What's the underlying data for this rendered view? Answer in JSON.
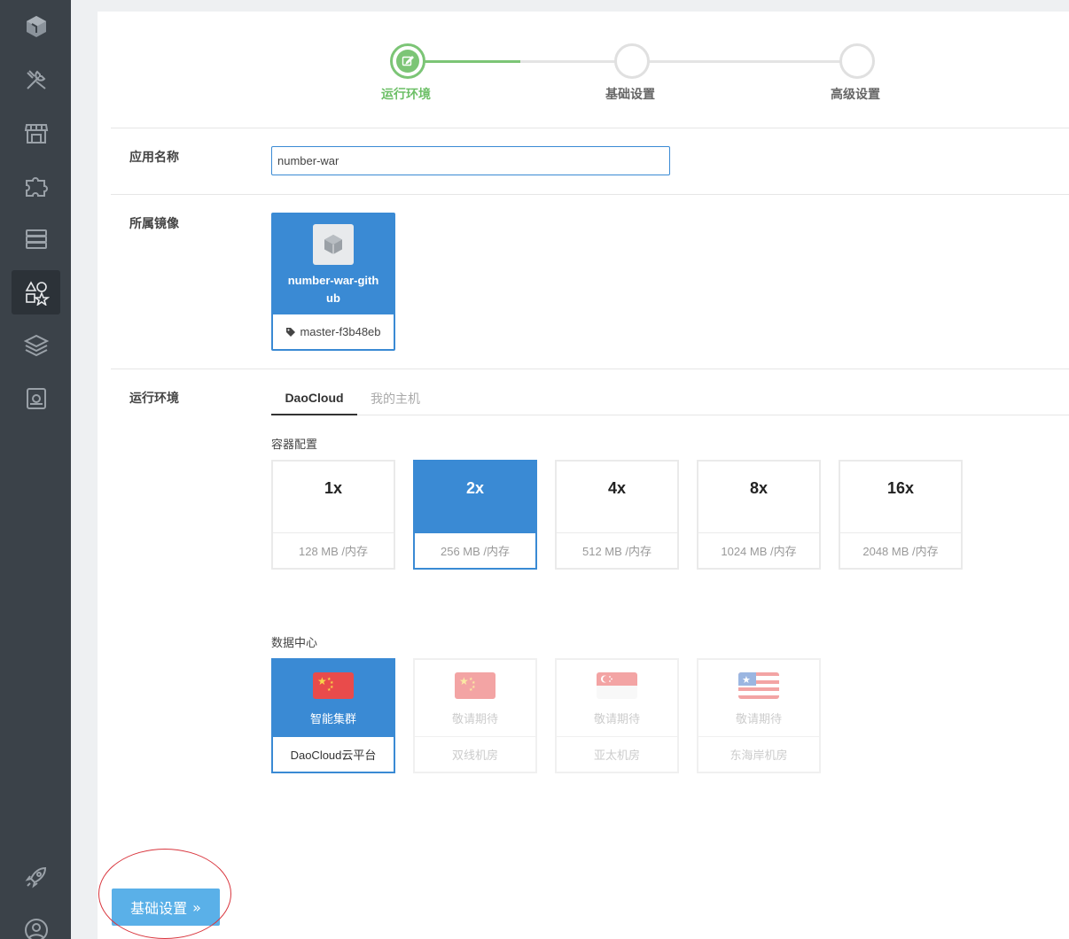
{
  "sidebar": {
    "items": [
      {
        "icon": "logo-cube-icon"
      },
      {
        "icon": "tools-icon"
      },
      {
        "icon": "store-icon"
      },
      {
        "icon": "puzzle-icon"
      },
      {
        "icon": "server-icon"
      },
      {
        "icon": "shapes-icon",
        "active": true
      },
      {
        "icon": "layers-icon"
      },
      {
        "icon": "disk-icon"
      },
      {
        "icon": "rocket-icon"
      },
      {
        "icon": "user-icon"
      }
    ]
  },
  "stepper": {
    "steps": [
      {
        "label": "运行环境",
        "state": "active"
      },
      {
        "label": "基础设置",
        "state": "pending"
      },
      {
        "label": "高级设置",
        "state": "pending"
      }
    ]
  },
  "form": {
    "app_name_label": "应用名称",
    "app_name_value": "number-war",
    "image_label": "所属镜像",
    "image": {
      "name": "number-war-github",
      "tag": "master-f3b48eb"
    },
    "runtime_label": "运行环境"
  },
  "tabs": [
    {
      "label": "DaoCloud",
      "active": true
    },
    {
      "label": "我的主机",
      "active": false
    }
  ],
  "container_config": {
    "title": "容器配置",
    "options": [
      {
        "size": "1x",
        "memory": "128 MB /内存",
        "selected": false
      },
      {
        "size": "2x",
        "memory": "256 MB /内存",
        "selected": true
      },
      {
        "size": "4x",
        "memory": "512 MB /内存",
        "selected": false
      },
      {
        "size": "8x",
        "memory": "1024 MB /内存",
        "selected": false
      },
      {
        "size": "16x",
        "memory": "2048 MB /内存",
        "selected": false
      }
    ]
  },
  "datacenter": {
    "title": "数据中心",
    "options": [
      {
        "flag": "china-flag-icon",
        "label": "智能集群",
        "name": "DaoCloud云平台",
        "selected": true
      },
      {
        "flag": "china-flag-icon",
        "label": "敬请期待",
        "name": "双线机房",
        "selected": false
      },
      {
        "flag": "singapore-flag-icon",
        "label": "敬请期待",
        "name": "亚太机房",
        "selected": false
      },
      {
        "flag": "usa-flag-icon",
        "label": "敬请期待",
        "name": "东海岸机房",
        "selected": false
      }
    ]
  },
  "next_button": {
    "label": "基础设置",
    "icon": "double-chevron-right-icon"
  },
  "colors": {
    "sidebar_bg": "#3b4249",
    "accent_blue": "#3a8ad4",
    "step_green": "#7cc576",
    "button_blue": "#5ab0e8",
    "annotation_red": "#d9363e"
  }
}
